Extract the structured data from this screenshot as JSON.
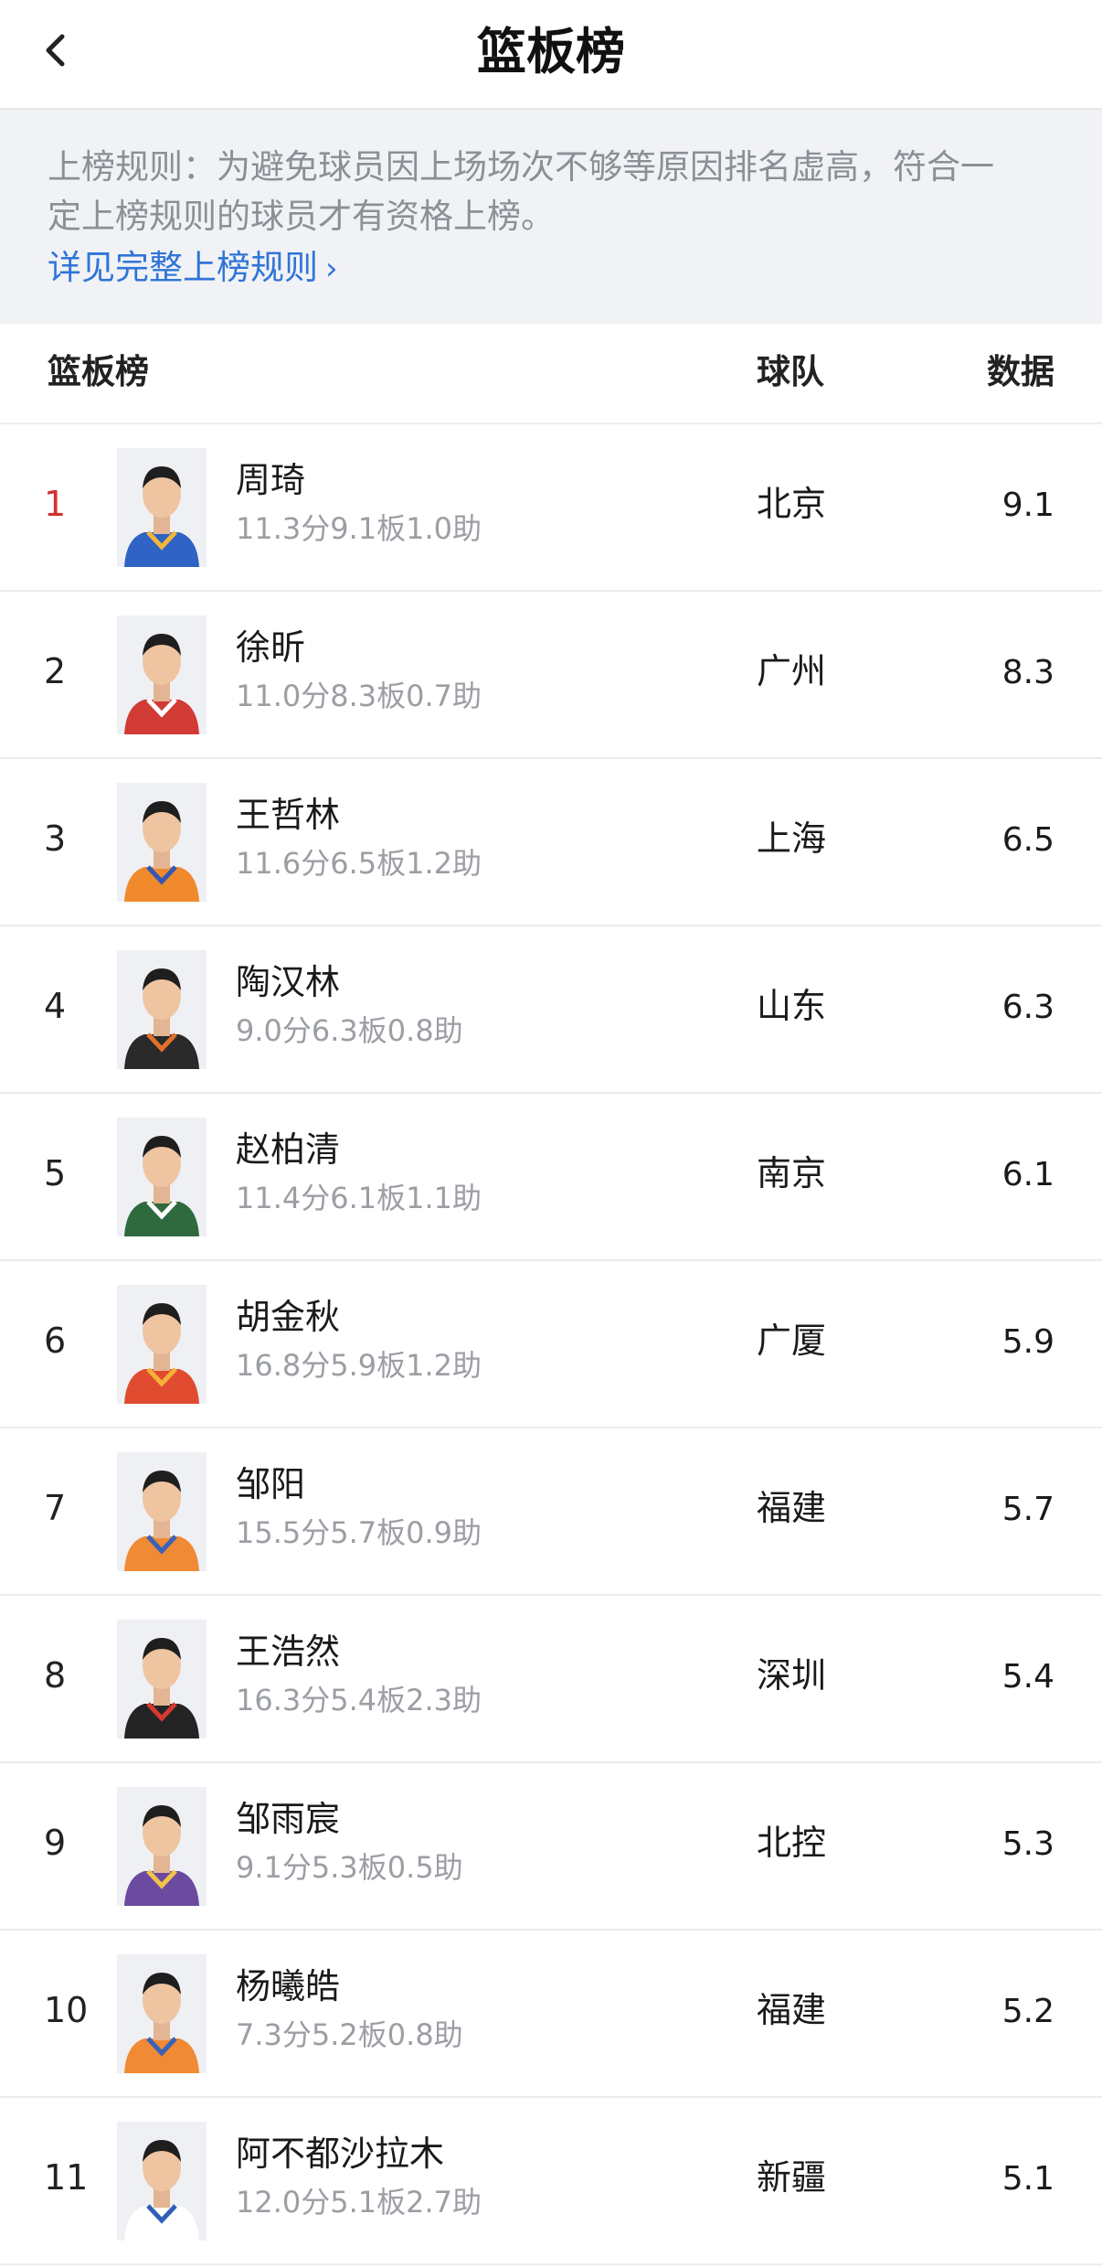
{
  "nav": {
    "title": "篮板榜"
  },
  "notice": {
    "line1": "上榜规则：为避免球员因上场场次不够等原因排名虚高，符合一",
    "line2": "定上榜规则的球员才有资格上榜。",
    "link": "详见完整上榜规则"
  },
  "table_header": {
    "board": "篮板榜",
    "team": "球队",
    "data": "数据"
  },
  "players": [
    {
      "rank": "1",
      "name": "周琦",
      "stats": "11.3分9.1板1.0助",
      "team": "北京",
      "value": "9.1",
      "jersey": "#2f63c4",
      "trim": "#f2b63c"
    },
    {
      "rank": "2",
      "name": "徐昕",
      "stats": "11.0分8.3板0.7助",
      "team": "广州",
      "value": "8.3",
      "jersey": "#d23a36",
      "trim": "#ffffff"
    },
    {
      "rank": "3",
      "name": "王哲林",
      "stats": "11.6分6.5板1.2助",
      "team": "上海",
      "value": "6.5",
      "jersey": "#f08a2c",
      "trim": "#3457b5"
    },
    {
      "rank": "4",
      "name": "陶汉林",
      "stats": "9.0分6.3板0.8助",
      "team": "山东",
      "value": "6.3",
      "jersey": "#2a2a2a",
      "trim": "#e2702c"
    },
    {
      "rank": "5",
      "name": "赵柏清",
      "stats": "11.4分6.1板1.1助",
      "team": "南京",
      "value": "6.1",
      "jersey": "#2f6a3f",
      "trim": "#ffffff"
    },
    {
      "rank": "6",
      "name": "胡金秋",
      "stats": "16.8分5.9板1.2助",
      "team": "广厦",
      "value": "5.9",
      "jersey": "#e04b2f",
      "trim": "#f4b13a"
    },
    {
      "rank": "7",
      "name": "邹阳",
      "stats": "15.5分5.7板0.9助",
      "team": "福建",
      "value": "5.7",
      "jersey": "#f08a34",
      "trim": "#3a62b8"
    },
    {
      "rank": "8",
      "name": "王浩然",
      "stats": "16.3分5.4板2.3助",
      "team": "深圳",
      "value": "5.4",
      "jersey": "#242424",
      "trim": "#d43a32"
    },
    {
      "rank": "9",
      "name": "邹雨宸",
      "stats": "9.1分5.3板0.5助",
      "team": "北控",
      "value": "5.3",
      "jersey": "#6b4aa0",
      "trim": "#f3c24a"
    },
    {
      "rank": "10",
      "name": "杨曦皓",
      "stats": "7.3分5.2板0.8助",
      "team": "福建",
      "value": "5.2",
      "jersey": "#f08a34",
      "trim": "#3a62b8"
    },
    {
      "rank": "11",
      "name": "阿不都沙拉木",
      "stats": "12.0分5.1板2.7助",
      "team": "新疆",
      "value": "5.1",
      "jersey": "#ffffff",
      "trim": "#2e5fb7"
    }
  ],
  "colors": {
    "accent_link": "#2f74d8",
    "rank_first": "#d0302f",
    "muted_text": "#9b9ea4"
  }
}
